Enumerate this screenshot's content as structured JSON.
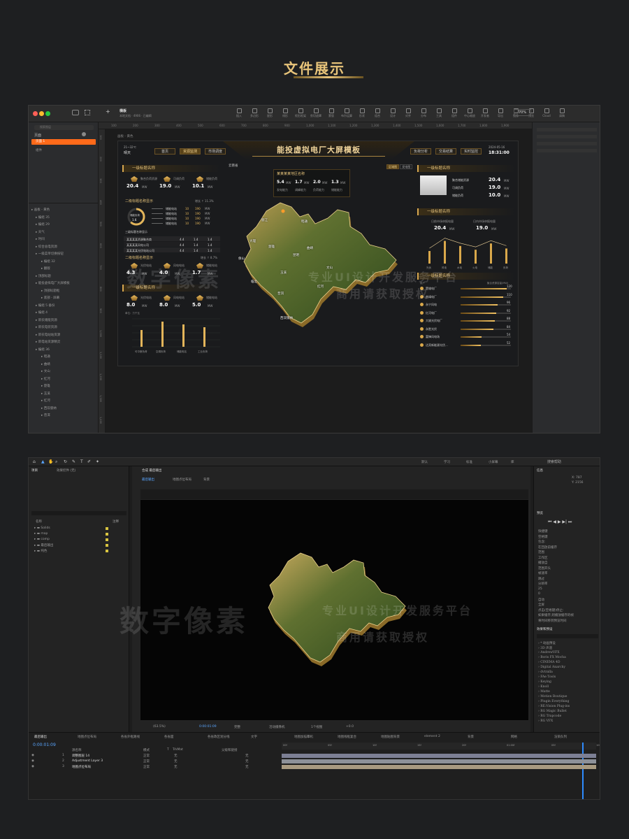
{
  "page": {
    "title": "文件展示"
  },
  "figma": {
    "file_name": "横板",
    "file_sub": "本地文档 · 4906 · 已编辑",
    "left_tabs": [
      "页面"
    ],
    "search_placeholder": "搜索图层",
    "pages": [
      "页面 1",
      "组件"
    ],
    "layers": [
      "画板 - 黄色",
      "编组 35",
      "编组 29",
      "天气",
      "时间",
      "综合总电资源",
      "一级菜单切换按钮",
      "编组 32",
      "翻版",
      "顶部标题",
      "能投虚拟电厂大屏模板",
      "顶部标题框",
      "底部 - 屏幕",
      "编组 5 备份",
      "编组 4",
      "新农储能资源",
      "新农电装资源",
      "新农电站站资源",
      "新电站资源精灵",
      "编组 36",
      "昭通",
      "曲靖",
      "文山",
      "红河",
      "楚雄",
      "玉溪",
      "红河",
      "西双版纳",
      "普洱"
    ],
    "toolbar": [
      "插入",
      "多边形",
      "星形",
      "线形",
      "矩形框架",
      "剪切遮罩",
      "蒙版",
      "布尔运算",
      "形状",
      "组合",
      "设计",
      "对齐",
      "分布",
      "工具",
      "组件",
      "中心缩放",
      "开发者",
      "导出",
      "镜像",
      "预览",
      "Cloud",
      "请稿"
    ],
    "zoom": "70%",
    "ruler_ticks": [
      "100",
      "200",
      "300",
      "400",
      "500",
      "600",
      "700",
      "800",
      "900",
      "1,000",
      "1,100",
      "1,200",
      "1,300",
      "1,400",
      "1,500",
      "1,600",
      "1,700",
      "1,800",
      "1,900"
    ],
    "side_ruler": [
      "100",
      "200",
      "300",
      "400",
      "500",
      "600",
      "700",
      "800",
      "900",
      "1,000",
      "1,100",
      "1,200",
      "1,300",
      "1,400"
    ],
    "canvas_label": "画板 - 黄色"
  },
  "dashboard": {
    "title": "能投虚拟电厂大屏模板",
    "weather": {
      "temp": "21~32℃",
      "desc": "晴天"
    },
    "datetime": {
      "date": "2024-05-16",
      "time": "18:31:00"
    },
    "tabs_left": [
      "首页",
      "资源监测",
      "市场调度"
    ],
    "tabs_right": [
      "负荷分析",
      "交易结算",
      "实时监控"
    ],
    "left_panel_title": "一级标题名称",
    "left_stats": [
      {
        "label": "聚合负荷资源",
        "value": "20.4",
        "unit": "MW"
      },
      {
        "label": "可调负荷",
        "value": "19.0",
        "unit": "MW"
      },
      {
        "label": "储能负荷",
        "value": "10.1",
        "unit": "MW"
      }
    ],
    "sub_title_1": "二级标题名称显示",
    "sub_title_1_note": "增长 ↑ 11.3%",
    "donut_label": "储能负荷",
    "donut_value": "1.6",
    "donut_pct": 0.62,
    "sub_rows": [
      {
        "name": "储能电站",
        "a": "10",
        "b": "190",
        "u": "MW"
      },
      {
        "name": "储能电站",
        "a": "10",
        "b": "190",
        "u": "MW"
      },
      {
        "name": "储能电站",
        "a": "10",
        "b": "190",
        "u": "MW"
      },
      {
        "name": "储能电站",
        "a": "10",
        "b": "190",
        "u": "MW"
      }
    ],
    "list_title": "三级标题名称显示",
    "list_rows": [
      {
        "name": "某某某某资源聚合商",
        "v1": "4.4",
        "v2": "1.4",
        "v3": "1.4"
      },
      {
        "name": "某某某某风电公司",
        "v1": "4.4",
        "v2": "1.4",
        "v3": "1.4"
      },
      {
        "name": "某某某某光伏电站公司",
        "v1": "4.4",
        "v2": "1.4",
        "v3": "1.4"
      }
    ],
    "sub_title_2": "二级标题名称显示",
    "sub_title_2_note": "增长 ↑ 8.7%",
    "left_stats_2": [
      {
        "label": "光伏电站",
        "value": "4.3",
        "unit": "MW"
      },
      {
        "label": "风电电站",
        "value": "4.0",
        "unit": "MW"
      },
      {
        "label": "储能电站",
        "value": "1.7",
        "unit": "MW"
      }
    ],
    "left_panel_title_2": "一级标题名称",
    "left_stats_3": [
      {
        "label": "光伏电站",
        "value": "8.0",
        "unit": "MW"
      },
      {
        "label": "风电电站",
        "value": "8.0",
        "unit": "MW"
      },
      {
        "label": "储能电站",
        "value": "5.0",
        "unit": "MW"
      }
    ],
    "bar_unit": "单位：万千瓦",
    "bar_categories": [
      "可中断负荷",
      "空调负荷",
      "储能电站",
      "工业负荷"
    ],
    "bar_values": [
      0.6,
      0.9,
      0.8,
      0.7
    ],
    "map_label": "云南省",
    "center_card_title": "某某某某地区名称",
    "center_stats": [
      {
        "value": "5.4",
        "unit": "MW",
        "label": "发电能力"
      },
      {
        "value": "1.7",
        "unit": "MW",
        "label": "调峰能力"
      },
      {
        "value": "2.0",
        "unit": "MW",
        "label": "负荷能力"
      },
      {
        "value": "1.3",
        "unit": "MW",
        "label": "储能能力"
      }
    ],
    "map_toggle": [
      "区域图",
      "发电图"
    ],
    "cities": [
      "昭通",
      "曲靖",
      "昆明",
      "楚雄",
      "大理",
      "玉溪",
      "临沧",
      "普洱",
      "文山",
      "红河",
      "西双版纳",
      "丽江",
      "保山"
    ],
    "right_panel_title": "一级标题名称",
    "right_stats": [
      {
        "label": "聚合储能资源",
        "value": "20.4",
        "unit": "MW"
      },
      {
        "label": "可调负荷",
        "value": "19.0",
        "unit": "MW"
      },
      {
        "label": "储能负荷",
        "value": "10.0",
        "unit": "MW"
      }
    ],
    "right_panel_title_2": "一级标题名称",
    "right_pair": [
      {
        "label": "日前市场申报电量",
        "value": "20.4",
        "unit": "MW"
      },
      {
        "label": "日内市场申报电量",
        "value": "19.0",
        "unit": "MW"
      }
    ],
    "right_bar_values": [
      0.5,
      0.9,
      0.7,
      0.55,
      0.8,
      0.6
    ],
    "right_bar_labels": [
      "光伏",
      "风电",
      "水电",
      "火电",
      "储能",
      "负荷"
    ],
    "right_panel_title_3": "一级标题名称",
    "rank_header": [
      "用户",
      "聚合资源容量(MW)"
    ],
    "ranks": [
      {
        "name": "楚雄电厂",
        "value": 120
      },
      {
        "name": "曲靖电厂",
        "value": 110
      },
      {
        "name": "永宁风电",
        "value": 96
      },
      {
        "name": "红河电厂",
        "value": 92
      },
      {
        "name": "大姚光伏电厂",
        "value": 88
      },
      {
        "name": "永胜光伏",
        "value": 84
      },
      {
        "name": "富锋风电场",
        "value": 54
      },
      {
        "name": "达亮新能源光伏...",
        "value": 52
      }
    ],
    "rank_max": 130
  },
  "watermark": {
    "big": "数字像素",
    "line1": "专业UI设计开发服务平台",
    "line2": "商用请获取授权"
  },
  "ae": {
    "menu": [
      "默认",
      "学习",
      "标准",
      "小屏幕",
      "库"
    ],
    "search_help": "搜索帮助",
    "project_tabs": [
      "项目",
      "效果控件 (无)"
    ],
    "project_cols": [
      "名称",
      "注释"
    ],
    "project_items": [
      "Solids",
      "map",
      "comp",
      "最后输出",
      "纯色"
    ],
    "comp_tabs": [
      "最后输出",
      "地图点位布局",
      "背景"
    ],
    "comp_title": "合成 最后输出",
    "viewer_footer": [
      "(63.5%)",
      "0:00:01:09",
      "完整",
      "活动摄像机",
      "1个视图",
      "+0.0"
    ],
    "info_title": "信息",
    "info_xy": [
      "X: 787",
      "Y: 2156"
    ],
    "preview_title": "预览",
    "preview_items": [
      "快捷键",
      "空格键",
      "包含:",
      "在回放前缓存",
      "范围",
      "工作区",
      "播放自",
      "范围开头",
      "帧速率",
      "跳过",
      "分辨率",
      "25",
      "0",
      "自动",
      "全屏",
      "点击(空格键)停止:",
      "如果缓存,则播放缓存的帧",
      "将时间移到预览时间"
    ],
    "effects_title": "效果和预设",
    "effects_list": [
      "* 动画预设",
      "3D 声道",
      "AndrewVFX",
      "Boris FX Mocha",
      "CINEMA 4D",
      "Digital Anarchy",
      "dvtralla",
      "FAe Tools",
      "Keying",
      "Knoll",
      "Matte",
      "Motion Boutique",
      "Plugin Everything",
      "RE:Vision Plug-ins",
      "RG Magic Bullet",
      "RG Trapcode",
      "RG VFX"
    ],
    "timeline_tabs": [
      "最后输出",
      "地图点位布局",
      "各省外框路线",
      "各省面",
      "各省政区划分线",
      "文字",
      "地图加描摹机",
      "地图线框复合",
      "地图贴图背景",
      "element 2",
      "背景",
      "网格",
      "渲染队列"
    ],
    "timecode": "0:00:01:09",
    "layer_cols": [
      "源名称",
      "模式",
      "T",
      "TrkMat",
      "父级和链接"
    ],
    "layers": [
      {
        "num": "1",
        "name": "调整图层 14",
        "mode": "正常"
      },
      {
        "num": "2",
        "name": "Adjustment Layer 3",
        "mode": "正常"
      },
      {
        "num": "3",
        "name": "地图点位布局",
        "mode": "正常"
      }
    ],
    "parent_none": "无",
    "time_ticks": [
      "00f",
      "05f",
      "10f",
      "15f",
      "20f",
      "01:00f",
      "05f",
      "10f"
    ]
  },
  "colors": {
    "gold": "#e8c47a",
    "orange": "#ff6a1a",
    "ae_blue": "#2e8bff"
  }
}
